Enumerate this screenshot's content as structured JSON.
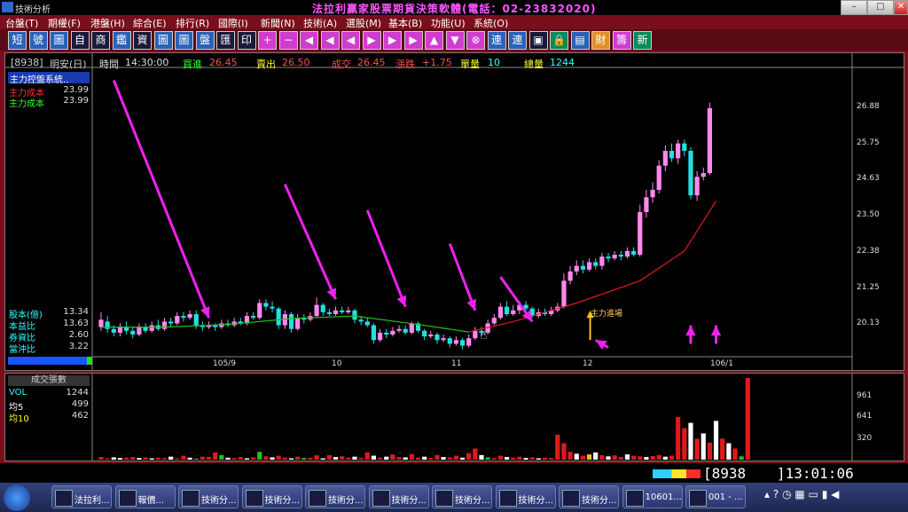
{
  "window": {
    "title": "技術分析",
    "brand": "法拉利贏家股票期貨決策軟體(電話：02-23832020)",
    "buttons": {
      "minimize": "–",
      "maximize": "□",
      "close": "✕"
    }
  },
  "menu": [
    "台盤(T)",
    "期權(F)",
    "港盤(H)",
    "綜合(E)",
    "排行(R)",
    "國際(I)",
    "新聞(N)",
    "技術(A)",
    "選股(M)",
    "基本(B)",
    "功能(U)",
    "系統(O)"
  ],
  "toolbar": [
    {
      "label": "短",
      "style": "blue"
    },
    {
      "label": "號",
      "style": "blue"
    },
    {
      "label": "圖",
      "style": "blue"
    },
    {
      "label": "自",
      "style": "dark"
    },
    {
      "label": "商",
      "style": "dark"
    },
    {
      "label": "鑑",
      "style": "blue"
    },
    {
      "label": "資",
      "style": "dark"
    },
    {
      "label": "圖",
      "style": "blue"
    },
    {
      "label": "圖",
      "style": "blue"
    },
    {
      "label": "盤",
      "style": "blue"
    },
    {
      "label": "匯",
      "style": "dark"
    },
    {
      "label": "印",
      "style": "dark"
    },
    {
      "label": "+",
      "style": "mag"
    },
    {
      "label": "−",
      "style": "mag"
    },
    {
      "label": "◀",
      "style": "mag"
    },
    {
      "label": "◀",
      "style": "mag"
    },
    {
      "label": "◀",
      "style": "mag"
    },
    {
      "label": "▶",
      "style": "mag"
    },
    {
      "label": "▶",
      "style": "mag"
    },
    {
      "label": "▶",
      "style": "mag"
    },
    {
      "label": "▲",
      "style": "mag"
    },
    {
      "label": "▼",
      "style": "mag"
    },
    {
      "label": "⊗",
      "style": "mag"
    },
    {
      "label": "連",
      "style": "blue"
    },
    {
      "label": "連",
      "style": "blue"
    },
    {
      "label": "▣",
      "style": "dark"
    },
    {
      "label": "🔒",
      "style": "grn"
    },
    {
      "label": "▤",
      "style": "blue"
    },
    {
      "label": "財",
      "style": "org"
    },
    {
      "label": "籌",
      "style": "mag"
    },
    {
      "label": "新",
      "style": "grn"
    }
  ],
  "quote": {
    "code": "[8938]",
    "name": "明安(日)",
    "time_label": "時間",
    "time": "14:30:00",
    "bid_label": "買進",
    "bid": "26.45",
    "ask_label": "賣出",
    "ask": "26.50",
    "deal_label": "成交",
    "deal": "26.45",
    "change_label": "漲跌",
    "change": "+1.75",
    "lot_label": "單量",
    "lot": "10",
    "total_label": "總量",
    "total": "1244"
  },
  "indicator_panel": {
    "title": "主力控盤系統..",
    "rows": [
      {
        "label": "主力成本",
        "value": "23.99",
        "color": "#ff3030"
      },
      {
        "label": "主力成本",
        "value": "23.99",
        "color": "#30ff30"
      }
    ]
  },
  "stats": [
    {
      "label": "股本(億)",
      "value": "13.34"
    },
    {
      "label": "本益比",
      "value": "13.63"
    },
    {
      "label": "券資比",
      "value": "2.60"
    },
    {
      "label": "當沖比",
      "value": "3.22"
    }
  ],
  "annotation": "主力進場",
  "y_ticks": [
    "26.88",
    "25.75",
    "24.63",
    "23.50",
    "22.38",
    "21.25",
    "20.13"
  ],
  "x_ticks": [
    "105/9",
    "10",
    "11",
    "12",
    "106/1"
  ],
  "volume_panel": {
    "title": "成交張數",
    "rows": [
      {
        "label": "VOL",
        "value": "1244",
        "color": "#30ffff"
      },
      {
        "label": "均5",
        "value": "499",
        "color": "#ffffff"
      },
      {
        "label": "均10",
        "value": "462",
        "color": "#ffff30"
      }
    ],
    "y_ticks": [
      "961",
      "641",
      "320"
    ]
  },
  "status": {
    "code": "8938",
    "clock": "13:01:06"
  },
  "taskbar": [
    {
      "label": "法拉利..."
    },
    {
      "label": "報價..."
    },
    {
      "label": "技術分..."
    },
    {
      "label": "技術分..."
    },
    {
      "label": "技術分..."
    },
    {
      "label": "技術分..."
    },
    {
      "label": "技術分..."
    },
    {
      "label": "技術分..."
    },
    {
      "label": "技術分..."
    },
    {
      "label": "10601..."
    },
    {
      "label": "001 - ..."
    }
  ],
  "colors": {
    "up": "#ff88ee",
    "down": "#22e0e0",
    "ma_green": "#22c022",
    "ma_red": "#e01a1a",
    "arrow": "#ee22ee"
  },
  "chart_data": {
    "type": "candlestick",
    "ylim": [
      19.8,
      27.5
    ],
    "candles": [
      [
        20.55,
        20.75,
        20.95,
        20.45
      ],
      [
        20.7,
        20.5,
        20.85,
        20.4
      ],
      [
        20.5,
        20.4,
        20.6,
        20.3
      ],
      [
        20.4,
        20.55,
        20.65,
        20.3
      ],
      [
        20.55,
        20.45,
        20.7,
        20.35
      ],
      [
        20.45,
        20.35,
        20.55,
        20.25
      ],
      [
        20.35,
        20.55,
        20.65,
        20.3
      ],
      [
        20.55,
        20.45,
        20.65,
        20.4
      ],
      [
        20.45,
        20.6,
        20.7,
        20.4
      ],
      [
        20.6,
        20.5,
        20.75,
        20.45
      ],
      [
        20.5,
        20.7,
        20.8,
        20.45
      ],
      [
        20.7,
        20.65,
        20.8,
        20.55
      ],
      [
        20.65,
        20.85,
        20.95,
        20.6
      ],
      [
        20.85,
        20.8,
        20.95,
        20.7
      ],
      [
        20.8,
        20.9,
        21.0,
        20.75
      ],
      [
        20.9,
        20.6,
        21.0,
        20.5
      ],
      [
        20.6,
        20.55,
        20.7,
        20.45
      ],
      [
        20.55,
        20.6,
        20.7,
        20.5
      ],
      [
        20.6,
        20.55,
        20.65,
        20.45
      ],
      [
        20.55,
        20.65,
        20.75,
        20.5
      ],
      [
        20.65,
        20.6,
        20.75,
        20.55
      ],
      [
        20.6,
        20.7,
        20.8,
        20.55
      ],
      [
        20.7,
        20.65,
        20.8,
        20.6
      ],
      [
        20.65,
        20.85,
        20.95,
        20.6
      ],
      [
        20.85,
        20.8,
        20.95,
        20.75
      ],
      [
        20.8,
        21.2,
        21.3,
        20.75
      ],
      [
        21.2,
        21.1,
        21.3,
        21.0
      ],
      [
        21.1,
        21.05,
        21.25,
        20.95
      ],
      [
        21.05,
        20.6,
        21.1,
        20.5
      ],
      [
        20.6,
        20.9,
        21.0,
        20.5
      ],
      [
        20.9,
        20.5,
        20.95,
        20.4
      ],
      [
        20.5,
        20.8,
        20.9,
        20.45
      ],
      [
        20.8,
        20.75,
        20.9,
        20.65
      ],
      [
        20.75,
        20.85,
        20.95,
        20.7
      ],
      [
        20.85,
        21.15,
        21.35,
        20.8
      ],
      [
        21.15,
        20.95,
        21.2,
        20.85
      ],
      [
        20.95,
        20.9,
        21.05,
        20.85
      ],
      [
        20.9,
        21.0,
        21.1,
        20.85
      ],
      [
        21.0,
        20.95,
        21.1,
        20.9
      ],
      [
        20.95,
        21.0,
        21.1,
        20.9
      ],
      [
        21.0,
        20.75,
        21.05,
        20.65
      ],
      [
        20.75,
        20.7,
        20.85,
        20.6
      ],
      [
        20.7,
        20.6,
        20.8,
        20.55
      ],
      [
        20.6,
        20.2,
        20.65,
        20.1
      ],
      [
        20.2,
        20.4,
        20.5,
        20.15
      ],
      [
        20.4,
        20.35,
        20.5,
        20.25
      ],
      [
        20.35,
        20.45,
        20.55,
        20.3
      ],
      [
        20.45,
        20.5,
        20.6,
        20.4
      ],
      [
        20.5,
        20.4,
        20.6,
        20.35
      ],
      [
        20.4,
        20.65,
        20.7,
        20.35
      ],
      [
        20.65,
        20.45,
        20.7,
        20.4
      ],
      [
        20.45,
        20.3,
        20.5,
        20.2
      ],
      [
        20.3,
        20.35,
        20.45,
        20.25
      ],
      [
        20.35,
        20.2,
        20.4,
        20.1
      ],
      [
        20.2,
        20.25,
        20.35,
        20.15
      ],
      [
        20.25,
        20.1,
        20.3,
        20.0
      ],
      [
        20.1,
        20.2,
        20.3,
        20.05
      ],
      [
        20.2,
        20.05,
        20.25,
        19.95
      ],
      [
        20.05,
        20.25,
        20.35,
        20.0
      ],
      [
        20.25,
        20.45,
        20.55,
        20.2
      ],
      [
        20.45,
        20.4,
        20.55,
        20.3
      ],
      [
        20.4,
        20.65,
        20.75,
        20.35
      ],
      [
        20.65,
        20.8,
        20.9,
        20.6
      ],
      [
        20.8,
        21.1,
        21.2,
        20.75
      ],
      [
        21.1,
        20.9,
        21.25,
        20.85
      ],
      [
        20.9,
        21.0,
        21.15,
        20.85
      ],
      [
        21.0,
        21.15,
        21.25,
        20.9
      ],
      [
        21.15,
        21.05,
        21.25,
        20.95
      ],
      [
        21.05,
        20.85,
        21.1,
        20.8
      ],
      [
        20.85,
        20.95,
        21.05,
        20.8
      ],
      [
        20.95,
        20.9,
        21.05,
        20.85
      ],
      [
        20.9,
        21.0,
        21.1,
        20.85
      ],
      [
        21.0,
        21.1,
        21.2,
        20.95
      ],
      [
        21.1,
        21.8,
        22.0,
        21.05
      ],
      [
        21.8,
        22.05,
        22.2,
        21.7
      ],
      [
        22.05,
        22.2,
        22.35,
        21.95
      ],
      [
        22.2,
        22.1,
        22.35,
        22.0
      ],
      [
        22.1,
        22.3,
        22.4,
        22.05
      ],
      [
        22.3,
        22.2,
        22.4,
        22.1
      ],
      [
        22.2,
        22.45,
        22.55,
        22.1
      ],
      [
        22.45,
        22.4,
        22.55,
        22.3
      ],
      [
        22.4,
        22.5,
        22.6,
        22.35
      ],
      [
        22.5,
        22.45,
        22.6,
        22.35
      ],
      [
        22.45,
        22.6,
        22.7,
        22.4
      ],
      [
        22.6,
        22.5,
        22.7,
        22.45
      ],
      [
        22.5,
        23.65,
        23.85,
        22.45
      ],
      [
        23.65,
        24.05,
        24.25,
        23.5
      ],
      [
        24.05,
        24.25,
        24.45,
        23.9
      ],
      [
        24.25,
        24.9,
        25.05,
        24.15
      ],
      [
        24.9,
        25.3,
        25.45,
        24.75
      ],
      [
        25.3,
        25.1,
        25.5,
        25.0
      ],
      [
        25.1,
        25.5,
        25.6,
        24.95
      ],
      [
        25.5,
        25.3,
        25.6,
        25.15
      ],
      [
        25.3,
        24.1,
        25.4,
        24.0
      ],
      [
        24.1,
        24.6,
        24.75,
        23.95
      ],
      [
        24.6,
        24.7,
        24.85,
        24.5
      ],
      [
        24.7,
        26.45,
        26.6,
        24.65
      ]
    ],
    "ma_green": [
      [
        0,
        20.55
      ],
      [
        10,
        20.55
      ],
      [
        20,
        20.62
      ],
      [
        30,
        20.78
      ],
      [
        40,
        20.85
      ],
      [
        50,
        20.62
      ],
      [
        58,
        20.42
      ]
    ],
    "ma_red": [
      [
        58,
        20.42
      ],
      [
        65,
        20.7
      ],
      [
        75,
        21.2
      ],
      [
        85,
        21.8
      ],
      [
        92,
        22.6
      ],
      [
        97,
        23.95
      ]
    ],
    "volume": [
      [
        40,
        "r"
      ],
      [
        20,
        "r"
      ],
      [
        35,
        "w"
      ],
      [
        25,
        "w"
      ],
      [
        30,
        "r"
      ],
      [
        40,
        "r"
      ],
      [
        25,
        "w"
      ],
      [
        35,
        "r"
      ],
      [
        20,
        "w"
      ],
      [
        30,
        "r"
      ],
      [
        25,
        "r"
      ],
      [
        45,
        "w"
      ],
      [
        20,
        "r"
      ],
      [
        60,
        "r"
      ],
      [
        30,
        "w"
      ],
      [
        15,
        "g"
      ],
      [
        45,
        "r"
      ],
      [
        40,
        "r"
      ],
      [
        110,
        "r"
      ],
      [
        70,
        "g"
      ],
      [
        30,
        "w"
      ],
      [
        25,
        "r"
      ],
      [
        40,
        "r"
      ],
      [
        20,
        "w"
      ],
      [
        35,
        "r"
      ],
      [
        120,
        "g"
      ],
      [
        50,
        "r"
      ],
      [
        35,
        "w"
      ],
      [
        60,
        "r"
      ],
      [
        30,
        "r"
      ],
      [
        20,
        "w"
      ],
      [
        45,
        "r"
      ],
      [
        25,
        "g"
      ],
      [
        30,
        "r"
      ],
      [
        65,
        "r"
      ],
      [
        20,
        "w"
      ],
      [
        70,
        "r"
      ],
      [
        40,
        "w"
      ],
      [
        50,
        "r"
      ],
      [
        30,
        "r"
      ],
      [
        45,
        "w"
      ],
      [
        25,
        "r"
      ],
      [
        110,
        "r"
      ],
      [
        60,
        "w"
      ],
      [
        30,
        "r"
      ],
      [
        45,
        "w"
      ],
      [
        80,
        "r"
      ],
      [
        40,
        "r"
      ],
      [
        35,
        "w"
      ],
      [
        85,
        "r"
      ],
      [
        30,
        "r"
      ],
      [
        45,
        "w"
      ],
      [
        25,
        "r"
      ],
      [
        70,
        "r"
      ],
      [
        40,
        "w"
      ],
      [
        35,
        "r"
      ],
      [
        60,
        "r"
      ],
      [
        30,
        "w"
      ],
      [
        100,
        "r"
      ],
      [
        170,
        "r"
      ],
      [
        70,
        "w"
      ],
      [
        35,
        "g"
      ],
      [
        25,
        "r"
      ],
      [
        60,
        "r"
      ],
      [
        40,
        "w"
      ],
      [
        30,
        "r"
      ],
      [
        45,
        "r"
      ],
      [
        25,
        "w"
      ],
      [
        35,
        "r"
      ],
      [
        20,
        "w"
      ],
      [
        30,
        "r"
      ],
      [
        25,
        "r"
      ],
      [
        380,
        "r"
      ],
      [
        250,
        "r"
      ],
      [
        120,
        "r"
      ],
      [
        90,
        "w"
      ],
      [
        60,
        "r"
      ],
      [
        80,
        "y"
      ],
      [
        110,
        "w"
      ],
      [
        70,
        "r"
      ],
      [
        50,
        "w"
      ],
      [
        65,
        "r"
      ],
      [
        40,
        "r"
      ],
      [
        80,
        "w"
      ],
      [
        60,
        "r"
      ],
      [
        50,
        "r"
      ],
      [
        40,
        "w"
      ],
      [
        55,
        "r"
      ],
      [
        70,
        "r"
      ],
      [
        45,
        "w"
      ],
      [
        60,
        "r"
      ],
      [
        650,
        "r"
      ],
      [
        480,
        "r"
      ],
      [
        560,
        "w"
      ],
      [
        320,
        "r"
      ],
      [
        400,
        "w"
      ],
      [
        260,
        "r"
      ],
      [
        590,
        "w"
      ],
      [
        320,
        "r"
      ],
      [
        250,
        "w"
      ],
      [
        170,
        "r"
      ],
      [
        50,
        "g"
      ],
      [
        1244,
        "r"
      ]
    ],
    "arrows": [
      {
        "from": [
          2,
          27.2
        ],
        "to": [
          17,
          20.8
        ]
      },
      {
        "from": [
          29,
          24.4
        ],
        "to": [
          37,
          21.3
        ]
      },
      {
        "from": [
          42,
          23.7
        ],
        "to": [
          48,
          21.1
        ]
      },
      {
        "from": [
          55,
          22.8
        ],
        "to": [
          59,
          21.0
        ]
      },
      {
        "from": [
          63,
          21.9
        ],
        "to": [
          68,
          20.7
        ]
      },
      {
        "from": [
          80,
          20.0
        ],
        "to": [
          78,
          20.2
        ]
      },
      {
        "from": [
          93,
          20.1
        ],
        "to": [
          93,
          20.6
        ]
      },
      {
        "from": [
          97,
          20.1
        ],
        "to": [
          97,
          20.6
        ]
      }
    ]
  }
}
